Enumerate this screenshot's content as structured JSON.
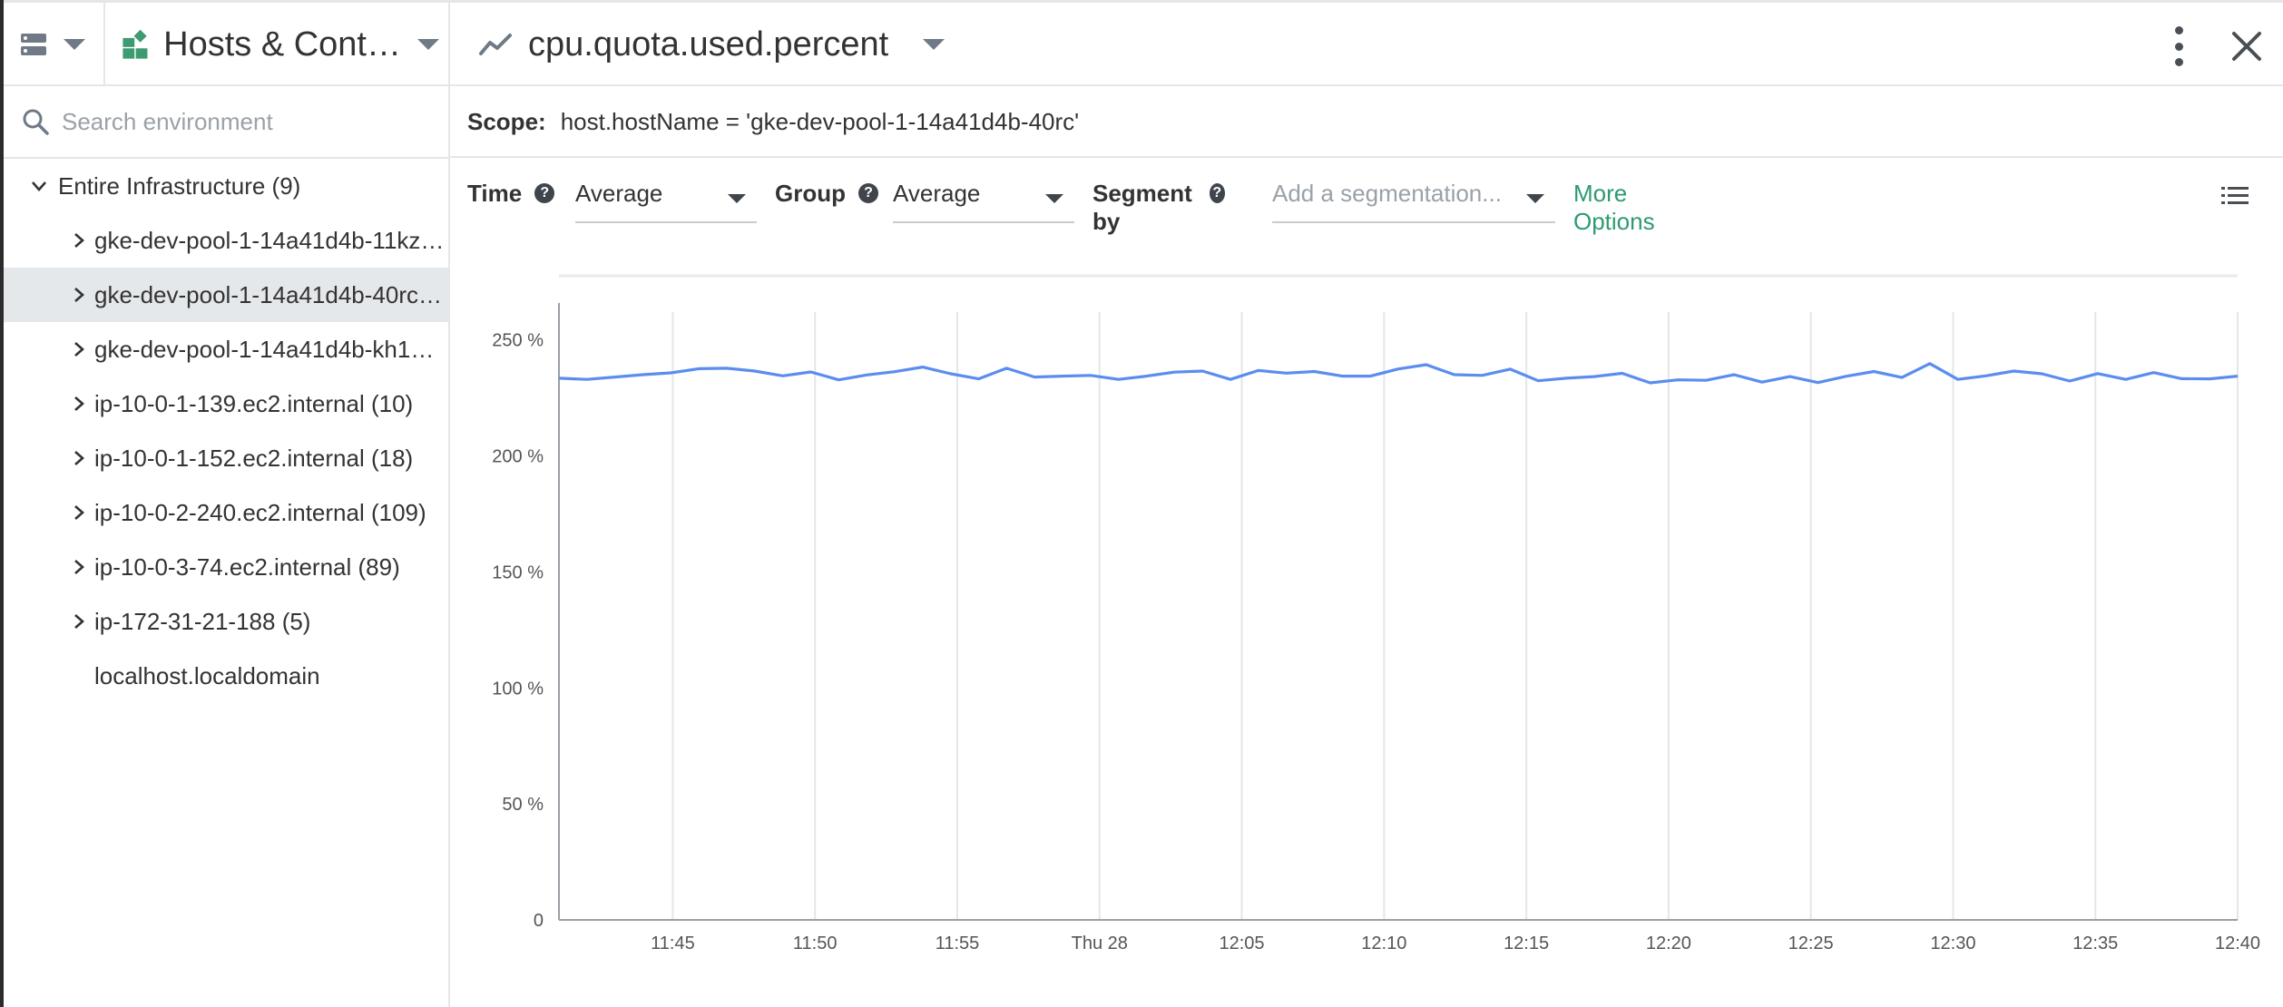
{
  "header": {
    "source_icon": "server-icon",
    "entity_icon": "hosts-containers-icon",
    "entity_title": "Hosts & Cont…",
    "metric_icon": "line-chart-icon",
    "metric_title": "cpu.quota.used.percent",
    "more_icon": "kebab-menu-icon",
    "close_icon": "close-icon"
  },
  "sidebar": {
    "search_placeholder": "Search environment",
    "root": {
      "label": "Entire Infrastructure (9)"
    },
    "items": [
      {
        "label": "gke-dev-pool-1-14a41d4b-11kz…",
        "expandable": true,
        "selected": false
      },
      {
        "label": "gke-dev-pool-1-14a41d4b-40rc…",
        "expandable": true,
        "selected": true
      },
      {
        "label": "gke-dev-pool-1-14a41d4b-kh1…",
        "expandable": true,
        "selected": false
      },
      {
        "label": "ip-10-0-1-139.ec2.internal (10)",
        "expandable": true,
        "selected": false
      },
      {
        "label": "ip-10-0-1-152.ec2.internal (18)",
        "expandable": true,
        "selected": false
      },
      {
        "label": "ip-10-0-2-240.ec2.internal (109)",
        "expandable": true,
        "selected": false
      },
      {
        "label": "ip-10-0-3-74.ec2.internal (89)",
        "expandable": true,
        "selected": false
      },
      {
        "label": "ip-172-31-21-188 (5)",
        "expandable": true,
        "selected": false
      },
      {
        "label": "localhost.localdomain",
        "expandable": false,
        "selected": false
      }
    ]
  },
  "scope": {
    "label": "Scope:",
    "value": "host.hostName = 'gke-dev-pool-1-14a41d4b-40rc'"
  },
  "toolbar": {
    "time_label": "Time",
    "time_value": "Average",
    "group_label": "Group",
    "group_value": "Average",
    "segment_label": "Segment by",
    "segment_placeholder": "Add a segmentation...",
    "more_options": "More Options",
    "help_glyph": "?"
  },
  "colors": {
    "series": "#5b8def",
    "accent_green": "#2e9a6f",
    "selected_row": "#e4e8eb"
  },
  "chart_data": {
    "type": "line",
    "ylim": [
      0,
      262
    ],
    "y_ticks": [
      0,
      50,
      100,
      150,
      200,
      250
    ],
    "y_tick_labels": [
      "0",
      "50 %",
      "100 %",
      "150 %",
      "200 %",
      "250 %"
    ],
    "x_tick_labels": [
      "11:45",
      "11:50",
      "11:55",
      "Thu 28",
      "12:05",
      "12:10",
      "12:15",
      "12:20",
      "12:25",
      "12:30",
      "12:35",
      "12:40"
    ],
    "x_start": "11:41",
    "x_end": "12:40",
    "grid": true,
    "series": [
      {
        "values": [
          233.5,
          233,
          234,
          235,
          235.8,
          237.6,
          237.8,
          236.6,
          234.5,
          236.2,
          232.8,
          234.9,
          236.3,
          238.3,
          235.4,
          233.2,
          237.8,
          234,
          234.4,
          234.7,
          233,
          234.4,
          236.1,
          236.6,
          233,
          236.8,
          235.7,
          236.4,
          234.4,
          234.4,
          237.5,
          239.3,
          235,
          234.7,
          237.4,
          232.4,
          233.5,
          234.2,
          235.6,
          231.5,
          232.8,
          232.6,
          235,
          231.8,
          234.2,
          231.6,
          234.3,
          236.4,
          233.8,
          239.8,
          233,
          234.5,
          236.6,
          235.4,
          232.3,
          235.5,
          233,
          235.9,
          233.3,
          233.2,
          234.4
        ]
      }
    ]
  }
}
